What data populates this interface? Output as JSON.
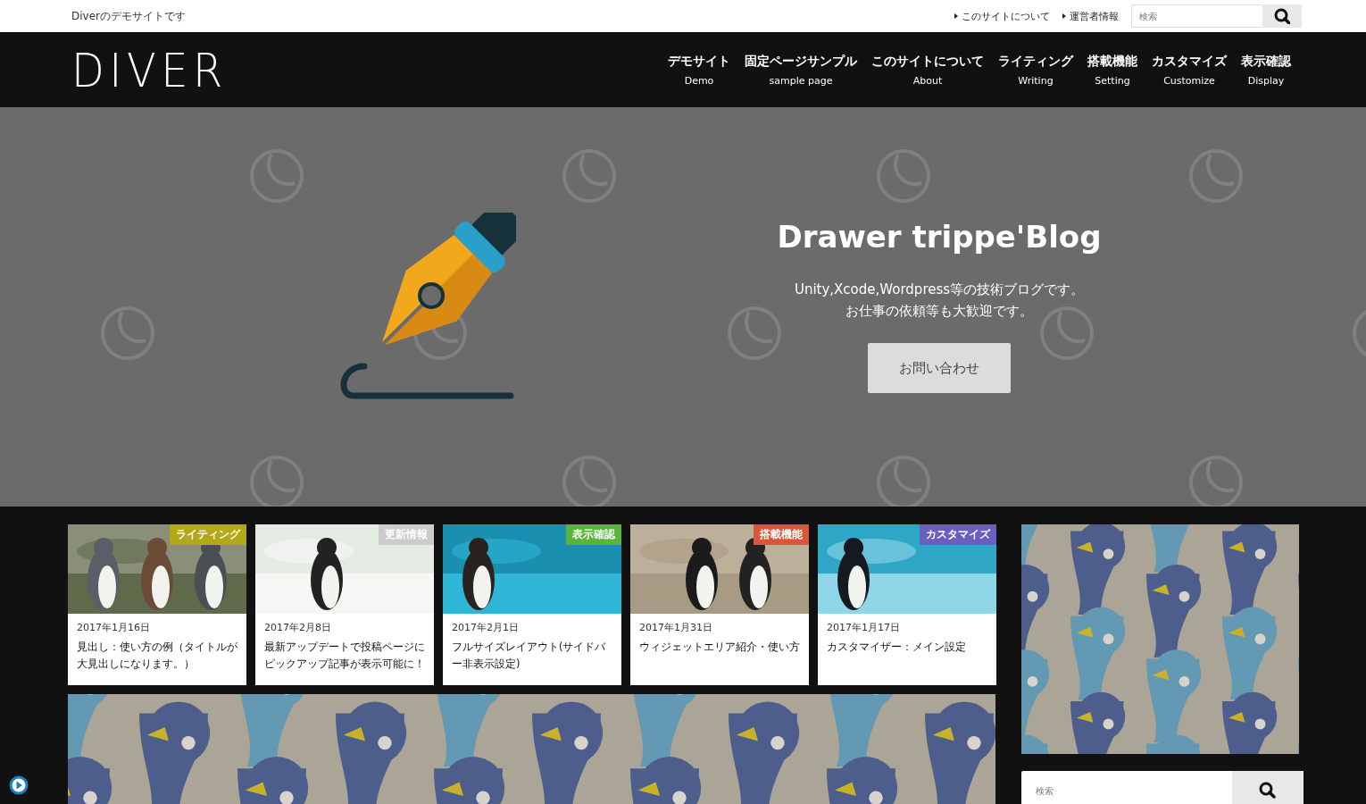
{
  "top_bar": {
    "tagline": "Diverのデモサイトです",
    "links": [
      "このサイトについて",
      "運営者情報"
    ],
    "search": {
      "placeholder": "検索"
    }
  },
  "header": {
    "logo": "DIVER",
    "nav": [
      {
        "label": "デモサイト",
        "sub": "Demo"
      },
      {
        "label": "固定ページサンプル",
        "sub": "sample page"
      },
      {
        "label": "このサイトについて",
        "sub": "About"
      },
      {
        "label": "ライティング",
        "sub": "Writing"
      },
      {
        "label": "搭載機能",
        "sub": "Setting"
      },
      {
        "label": "カスタマイズ",
        "sub": "Customize"
      },
      {
        "label": "表示確認",
        "sub": "Display"
      }
    ]
  },
  "hero": {
    "title": "Drawer trippe'Blog",
    "description": [
      "Unity,Xcode,Wordpress等の技術ブログです。",
      "お仕事の依頼等も大歓迎です。"
    ],
    "button": "お問い合わせ"
  },
  "posts": [
    {
      "category": "ライティング",
      "color": "#b3a81b",
      "date": "2017年1月16日",
      "title": "見出し：使い方の例（タイトルが大見出しになります。）"
    },
    {
      "category": "更新情報",
      "color": "#cccccc",
      "date": "2017年2月8日",
      "title": "最新アップデートで投稿ページにピックアップ記事が表示可能に！"
    },
    {
      "category": "表示確認",
      "color": "#5bb43a",
      "date": "2017年2月1日",
      "title": "フルサイズレイアウト(サイドバー非表示設定)"
    },
    {
      "category": "搭載機能",
      "color": "#d9563d",
      "date": "2017年1月31日",
      "title": "ウィジェットエリア紹介・使い方"
    },
    {
      "category": "カスタマイズ",
      "color": "#6a5fbe",
      "date": "2017年1月17日",
      "title": "カスタマイザー：メイン設定"
    }
  ],
  "sidebar": {
    "search": {
      "placeholder": "検索"
    }
  }
}
